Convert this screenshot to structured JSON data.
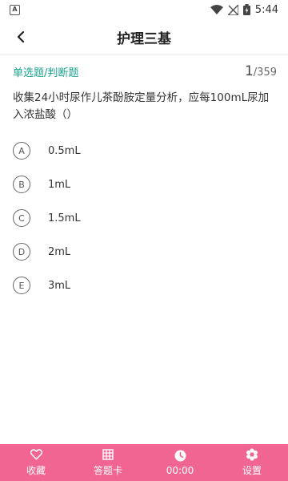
{
  "status_bar": {
    "left_icon": "A",
    "time": "5:44",
    "icons": [
      "wifi-icon",
      "signal-off-icon",
      "battery-charging-icon"
    ]
  },
  "header": {
    "title": "护理三基",
    "back_icon": "chevron-left-icon"
  },
  "question": {
    "type_label": "单选题/判断题",
    "current": "1",
    "total": "/359",
    "text": "收集24小时尿作儿茶酚胺定量分析，应每100mL尿加入浓盐酸（）",
    "options": [
      {
        "letter": "A",
        "text": "0.5mL"
      },
      {
        "letter": "B",
        "text": "1mL"
      },
      {
        "letter": "C",
        "text": "1.5mL"
      },
      {
        "letter": "D",
        "text": "2mL"
      },
      {
        "letter": "E",
        "text": "3mL"
      }
    ]
  },
  "bottom_bar": {
    "color": "#f06592",
    "tabs": [
      {
        "icon": "heart-icon",
        "label": "收藏"
      },
      {
        "icon": "grid-icon",
        "label": "答题卡"
      },
      {
        "icon": "clock-icon",
        "label": "00:00"
      },
      {
        "icon": "gear-icon",
        "label": "设置"
      }
    ]
  }
}
